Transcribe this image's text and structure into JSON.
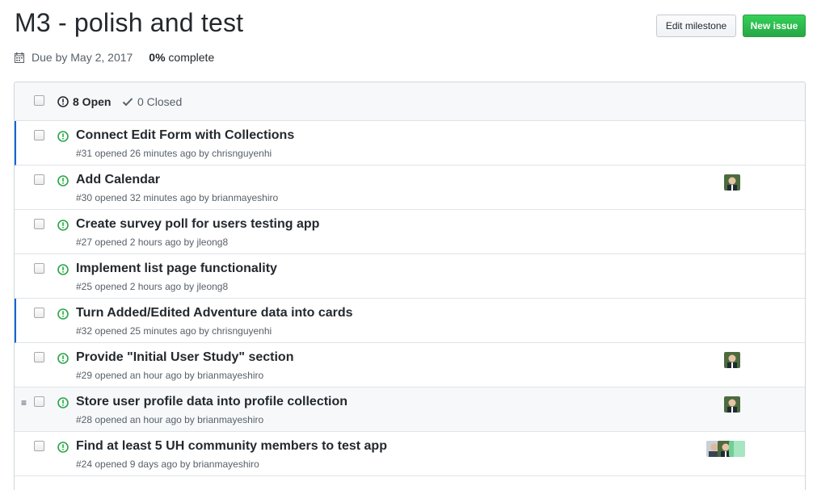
{
  "milestone": {
    "title": "M3 - polish and test",
    "due": "Due by May 2, 2017",
    "percent": "0%",
    "complete_label": "complete",
    "edit_button": "Edit milestone",
    "new_issue_button": "New issue"
  },
  "states": {
    "open_label": "8 Open",
    "closed_label": "0 Closed"
  },
  "issues": [
    {
      "title": "Connect Edit Form with Collections",
      "meta": "#31 opened 26 minutes ago by chrisnguyenhi",
      "assignees": []
    },
    {
      "title": "Add Calendar",
      "meta": "#30 opened 32 minutes ago by brianmayeshiro",
      "assignees": [
        "brianmayeshiro"
      ]
    },
    {
      "title": "Create survey poll for users testing app",
      "meta": "#27 opened 2 hours ago by jleong8",
      "assignees": []
    },
    {
      "title": "Implement list page functionality",
      "meta": "#25 opened 2 hours ago by jleong8",
      "assignees": []
    },
    {
      "title": "Turn Added/Edited Adventure data into cards",
      "meta": "#32 opened 25 minutes ago by chrisnguyenhi",
      "assignees": []
    },
    {
      "title": "Provide \"Initial User Study\" section",
      "meta": "#29 opened an hour ago by brianmayeshiro",
      "assignees": [
        "brianmayeshiro"
      ]
    },
    {
      "title": "Store user profile data into profile collection",
      "meta": "#28 opened an hour ago by brianmayeshiro",
      "assignees": [
        "brianmayeshiro"
      ]
    },
    {
      "title": "Find at least 5 UH community members to test app",
      "meta": "#24 opened 9 days ago by brianmayeshiro",
      "assignees": [
        "jleong8",
        "brianmayeshiro",
        "chrisnguyenhi"
      ]
    }
  ],
  "colors": {
    "open_green": "#28a745",
    "link_blue": "#0366d6"
  }
}
